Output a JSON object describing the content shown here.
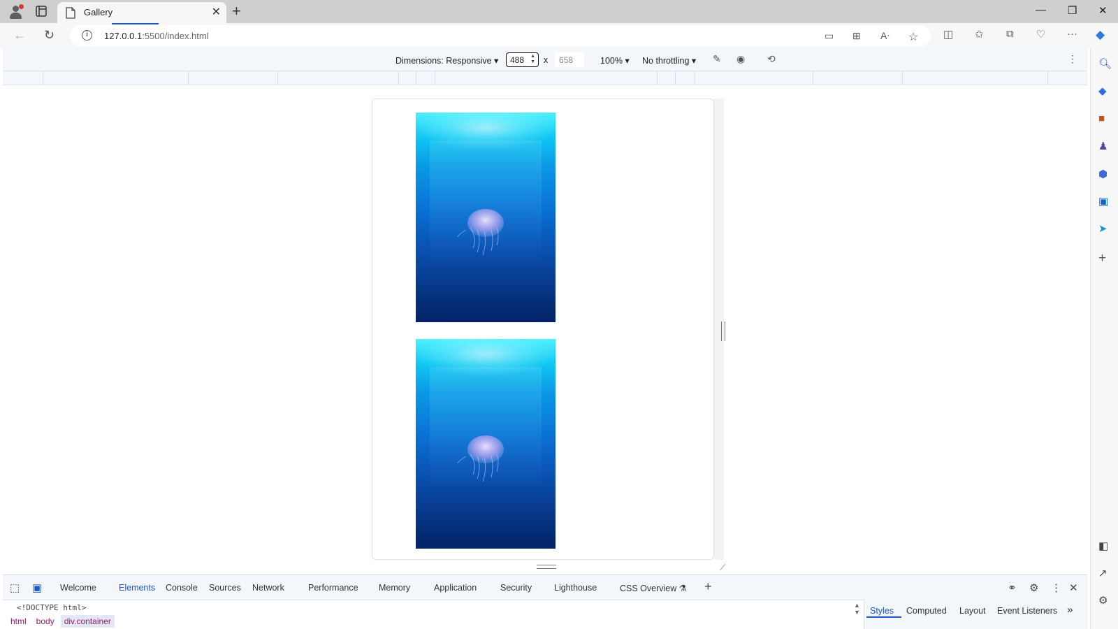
{
  "browser": {
    "tab_title": "Gallery",
    "url_host": "127.0.0.1",
    "url_path": ":5500/index.html"
  },
  "device_toolbar": {
    "dimensions_label": "Dimensions: Responsive",
    "width": "488",
    "times": "x",
    "height": "658",
    "zoom": "100%",
    "throttling": "No throttling"
  },
  "gallery": {
    "images": [
      {
        "subject": "jellyfish underwater"
      },
      {
        "subject": "jellyfish underwater"
      }
    ]
  },
  "devtools": {
    "tabs": [
      "Welcome",
      "Elements",
      "Console",
      "Sources",
      "Network",
      "Performance",
      "Memory",
      "Application",
      "Security",
      "Lighthouse",
      "CSS Overview"
    ],
    "active_tab": "Elements",
    "doctype": "<!DOCTYPE html>",
    "breadcrumbs": [
      "html",
      "body",
      "div.container"
    ],
    "side_tabs": [
      "Styles",
      "Computed",
      "Layout",
      "Event Listeners"
    ]
  },
  "colors": {
    "accent": "#1a56c9",
    "crumb": "#8a1f6e",
    "ocean_top": "#4ff0ff",
    "ocean_bottom": "#032266"
  }
}
